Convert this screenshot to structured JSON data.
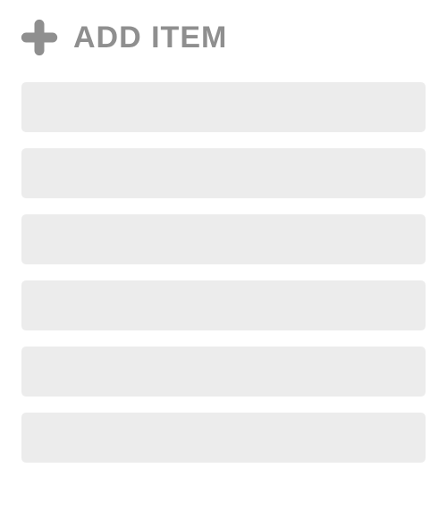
{
  "header": {
    "add_item_label": "ADD ITEM"
  },
  "items": [
    {
      "label": ""
    },
    {
      "label": ""
    },
    {
      "label": ""
    },
    {
      "label": ""
    },
    {
      "label": ""
    },
    {
      "label": ""
    }
  ],
  "colors": {
    "icon": "#8f8f8f",
    "text": "#8f8f8f",
    "item_bg": "#ececec"
  }
}
